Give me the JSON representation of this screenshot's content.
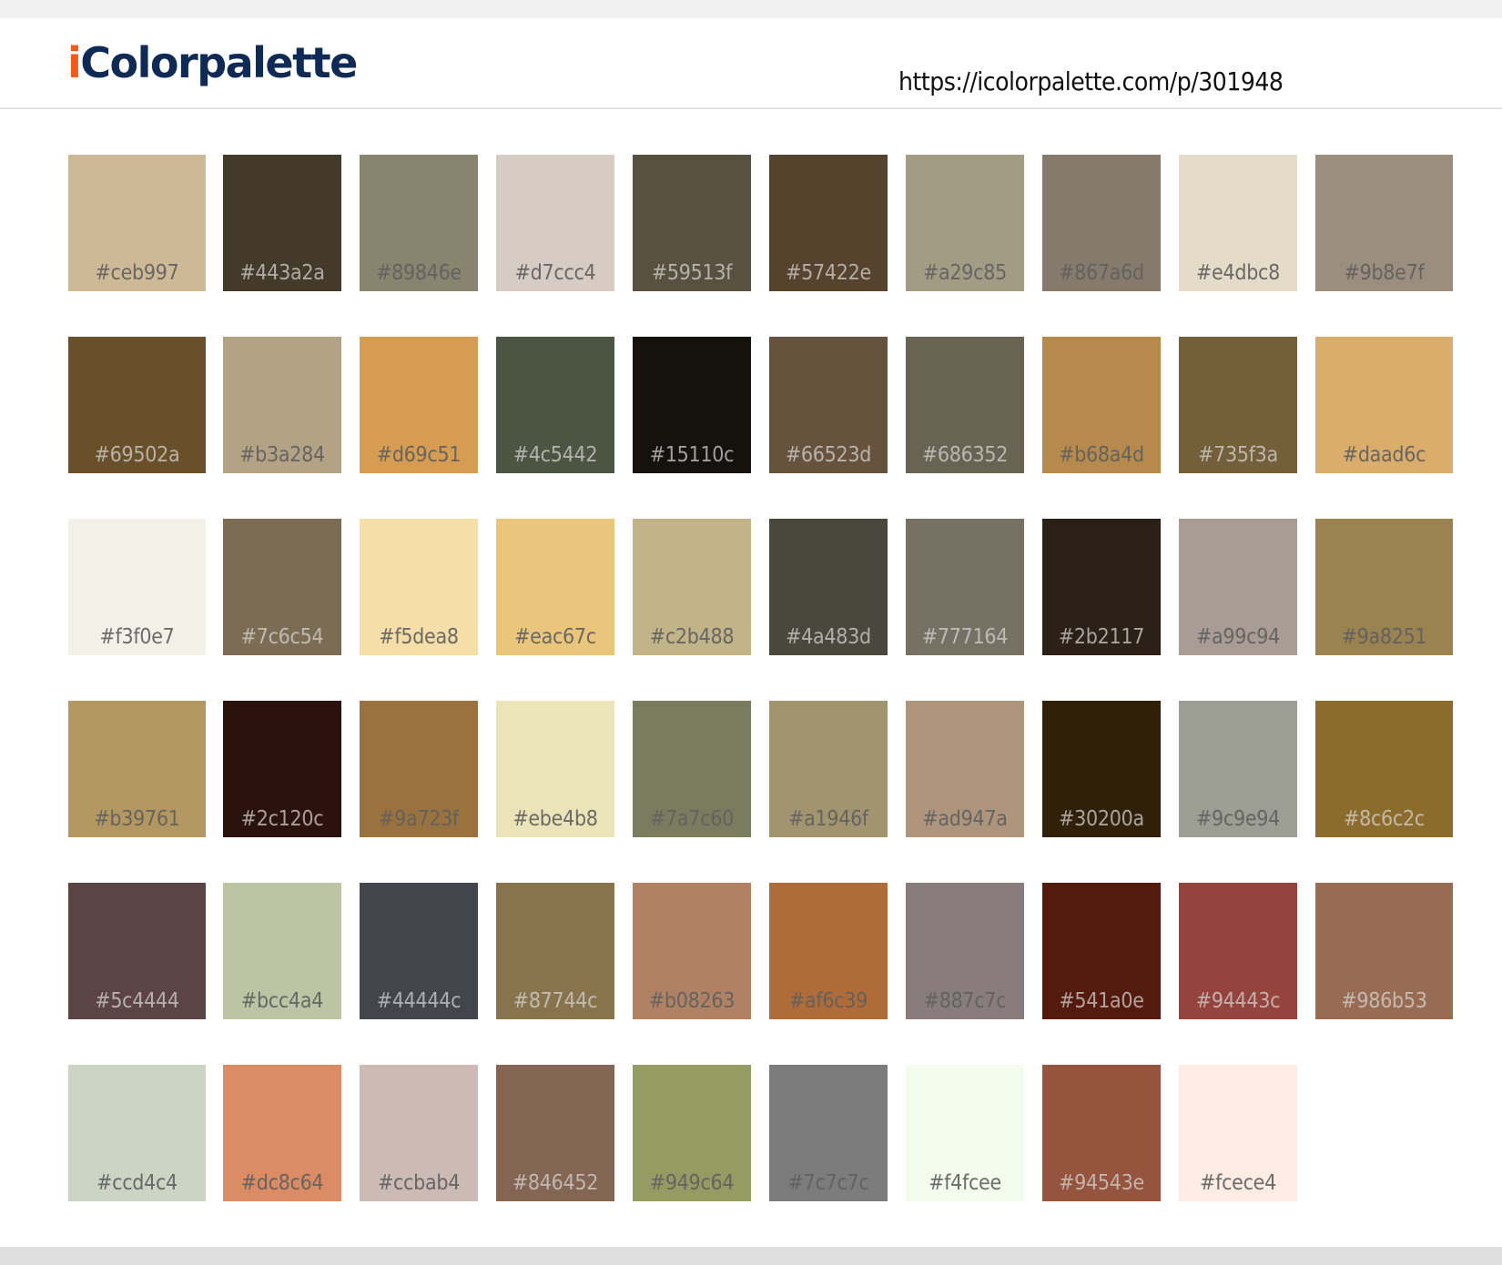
{
  "header": {
    "logo_prefix": "i",
    "logo_rest": "Colorpalette",
    "url": "https://icolorpalette.com/p/301948"
  },
  "palette": [
    [
      "#ceb997",
      "#443a2a",
      "#89846e",
      "#d7ccc4",
      "#59513f",
      "#57422e",
      "#a29c85",
      "#867a6d",
      "#e4dbc8",
      "#9b8e7f"
    ],
    [
      "#69502a",
      "#b3a284",
      "#d69c51",
      "#4c5442",
      "#15110c",
      "#66523d",
      "#686352",
      "#b68a4d",
      "#735f3a",
      "#daad6c"
    ],
    [
      "#f3f0e7",
      "#7c6c54",
      "#f5dea8",
      "#eac67c",
      "#c2b488",
      "#4a483d",
      "#777164",
      "#2b2117",
      "#a99c94",
      "#9a8251"
    ],
    [
      "#b39761",
      "#2c120c",
      "#9a723f",
      "#ebe4b8",
      "#7a7c60",
      "#a1946f",
      "#ad947a",
      "#30200a",
      "#9c9e94",
      "#8c6c2c"
    ],
    [
      "#5c4444",
      "#bcc4a4",
      "#44444c",
      "#87744c",
      "#b08263",
      "#af6c39",
      "#887c7c",
      "#541a0e",
      "#94443c",
      "#986b53"
    ],
    [
      "#ccd4c4",
      "#dc8c64",
      "#ccbab4",
      "#846452",
      "#949c64",
      "#7c7c7c",
      "#f4fcee",
      "#94543e",
      "#fcece4"
    ]
  ]
}
